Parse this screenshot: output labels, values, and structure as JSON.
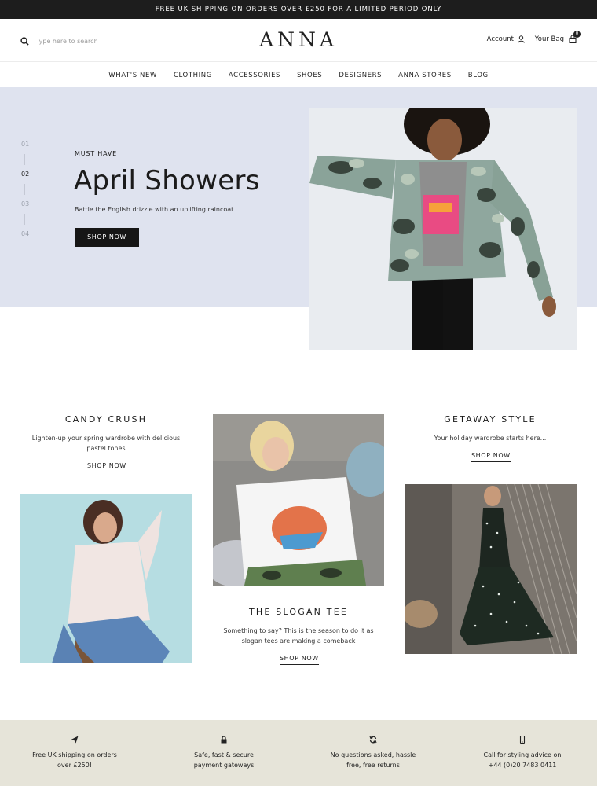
{
  "announcement": "FREE UK SHIPPING ON ORDERS OVER £250 FOR A LIMITED PERIOD ONLY",
  "header": {
    "search_placeholder": "Type here to search",
    "logo": "ANNA",
    "account_label": "Account",
    "bag_label": "Your Bag",
    "bag_count": "0"
  },
  "nav": [
    "WHAT'S NEW",
    "CLOTHING",
    "ACCESSORIES",
    "SHOES",
    "DESIGNERS",
    "ANNA STORES",
    "BLOG"
  ],
  "hero": {
    "steps": [
      "01",
      "02",
      "03",
      "04"
    ],
    "active_step": "02",
    "eyebrow": "MUST HAVE",
    "title": "April Showers",
    "subtitle": "Battle the English drizzle with an uplifting raincoat...",
    "button": "SHOP NOW"
  },
  "promos": {
    "candy": {
      "title": "CANDY CRUSH",
      "text_1": "Lighten-up your spring wardrobe with delicious",
      "text_2": "pastel tones",
      "link": "SHOP NOW"
    },
    "slogan": {
      "title": "THE SLOGAN TEE",
      "text_1": "Something to say? This is the season to do it as",
      "text_2": "slogan tees are making a comeback",
      "link": "SHOP NOW"
    },
    "getaway": {
      "title": "GETAWAY STYLE",
      "text_1": "Your holiday wardrobe starts here...",
      "link": "SHOP NOW"
    }
  },
  "usps": [
    {
      "icon": "paper-plane-icon",
      "line_1": "Free UK shipping on orders",
      "line_2": "over £250!"
    },
    {
      "icon": "lock-icon",
      "line_1": "Safe, fast & secure",
      "line_2": "payment gateways"
    },
    {
      "icon": "refresh-icon",
      "line_1": "No questions asked, hassle",
      "line_2": "free, free returns"
    },
    {
      "icon": "mobile-phone-icon",
      "line_1": "Call for styling advice on",
      "line_2": "+44 (0)20 7483 0411"
    }
  ],
  "colors": {
    "hero_bg": "#dfe3ef",
    "usp_bg": "#e6e4d9",
    "dark": "#161616"
  }
}
